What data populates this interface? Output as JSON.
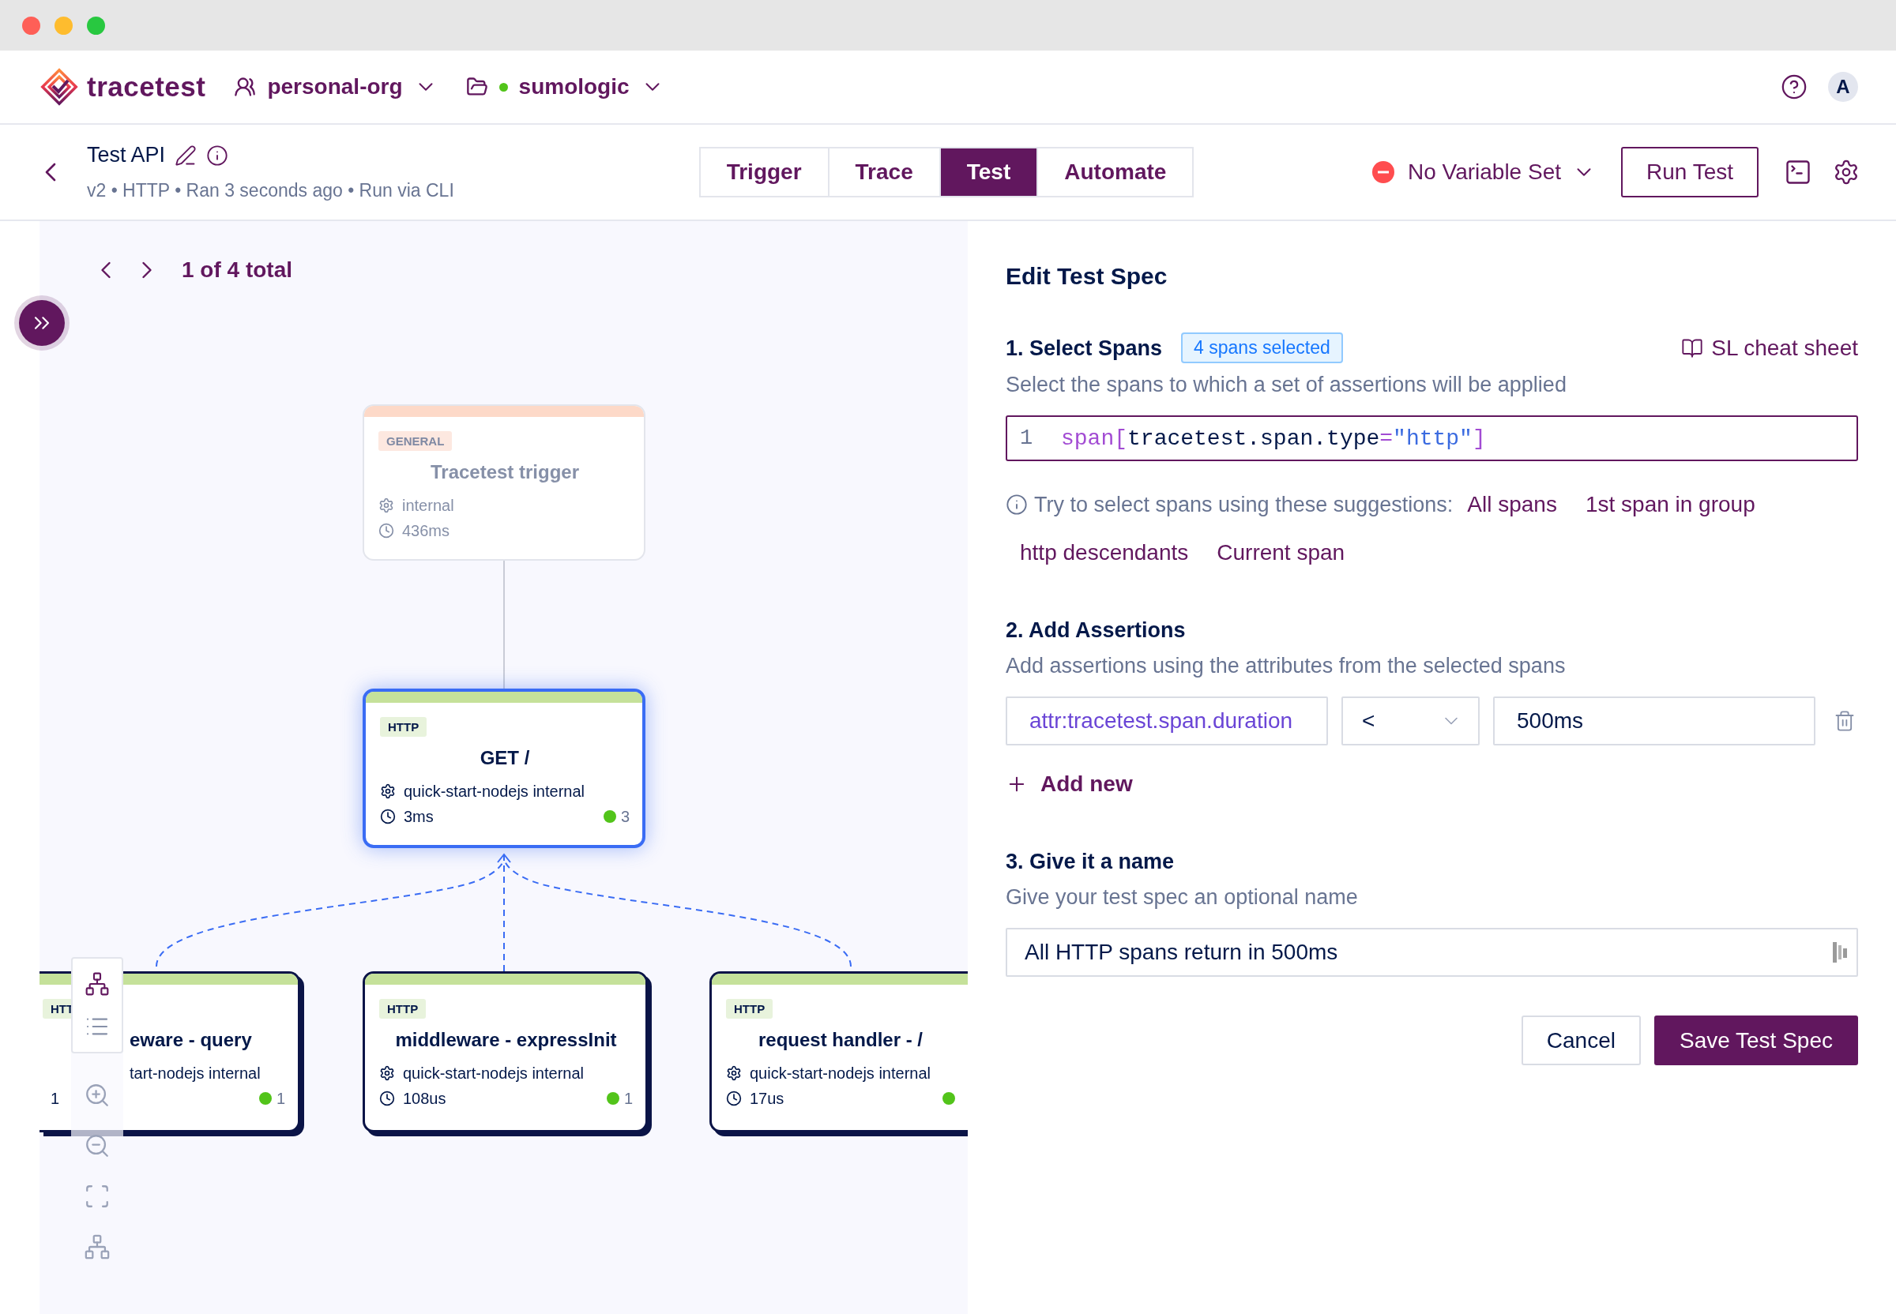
{
  "topbar": {
    "logo": "tracetest",
    "org": "personal-org",
    "project": "sumologic",
    "avatar": "A"
  },
  "test": {
    "title": "Test API",
    "meta": "v2 • HTTP • Ran 3 seconds ago • Run via CLI"
  },
  "tabs": [
    {
      "label": "Trigger",
      "selected": false
    },
    {
      "label": "Trace",
      "selected": false
    },
    {
      "label": "Test",
      "selected": true
    },
    {
      "label": "Automate",
      "selected": false
    }
  ],
  "variable_set": "No Variable Set",
  "run_button": "Run Test",
  "canvas": {
    "pager": "1 of 4 total",
    "nodes": [
      {
        "kind": "general",
        "badge": "GENERAL",
        "name": "Tracetest trigger",
        "service": "internal",
        "duration": "436ms",
        "selected": false
      },
      {
        "kind": "http",
        "badge": "HTTP",
        "name": "GET /",
        "service": "quick-start-nodejs internal",
        "duration": "3ms",
        "checks": "3",
        "selected": true
      },
      {
        "kind": "http",
        "badge": "HTT",
        "name": "eware - query",
        "service": "tart-nodejs internal",
        "duration": "1",
        "checks": "1",
        "selected": false
      },
      {
        "kind": "http",
        "badge": "HTTP",
        "name": "middleware - expressInit",
        "service": "quick-start-nodejs internal",
        "duration": "108us",
        "checks": "1",
        "selected": false
      },
      {
        "kind": "http",
        "badge": "HTTP",
        "name": "request handler - /",
        "service": "quick-start-nodejs internal",
        "duration": "17us",
        "selected": false
      }
    ]
  },
  "spec": {
    "title": "Edit Test Spec",
    "select_spans": {
      "heading": "1. Select Spans",
      "badge": "4 spans selected",
      "cheat_sheet": "SL cheat sheet",
      "description": "Select the spans to which a set of assertions will be applied",
      "query": {
        "line_number": "1",
        "tokens": [
          {
            "text": "span",
            "kind": "keyword"
          },
          {
            "text": "[",
            "kind": "bracket"
          },
          {
            "text": "tracetest.span.type",
            "kind": "attribute"
          },
          {
            "text": "=",
            "kind": "operator"
          },
          {
            "text": "\"http\"",
            "kind": "string"
          },
          {
            "text": "]",
            "kind": "bracket"
          }
        ]
      },
      "hint": "Try to select spans using these suggestions:",
      "suggestions": [
        "All spans",
        "1st span in group",
        "http descendants",
        "Current span"
      ]
    },
    "assertions": {
      "heading": "2. Add Assertions",
      "description": "Add assertions using the attributes from the selected spans",
      "rows": [
        {
          "attribute": "attr:tracetest.span.duration",
          "operator": "<",
          "value": "500ms"
        }
      ],
      "add_button": "Add new"
    },
    "name": {
      "heading": "3. Give it a name",
      "description": "Give your test spec an optional name",
      "value": "All HTTP spans return in 500ms"
    },
    "buttons": {
      "cancel": "Cancel",
      "save": "Save Test Spec"
    }
  }
}
